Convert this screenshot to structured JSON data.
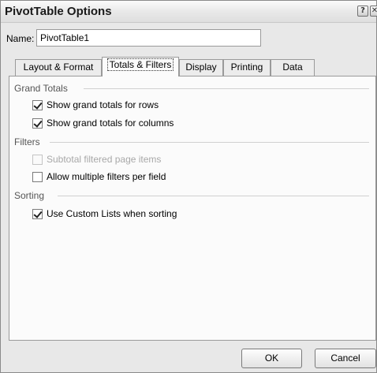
{
  "window": {
    "title": "PivotTable Options",
    "help_glyph": "?",
    "close_glyph": "✕"
  },
  "name_field": {
    "label": "Name:",
    "value": "PivotTable1"
  },
  "tabs": [
    {
      "label": "Layout & Format"
    },
    {
      "label": "Totals & Filters",
      "active": true
    },
    {
      "label": "Display"
    },
    {
      "label": "Printing"
    },
    {
      "label": "Data"
    }
  ],
  "grand_totals": {
    "heading": "Grand Totals",
    "show_rows": {
      "label": "Show grand totals for rows",
      "checked": true
    },
    "show_columns": {
      "label": "Show grand totals for columns",
      "checked": true
    }
  },
  "filters": {
    "heading": "Filters",
    "subtotal_filtered": {
      "label": "Subtotal filtered page items",
      "checked": false,
      "disabled": true
    },
    "allow_multiple": {
      "label": "Allow multiple filters per field",
      "checked": false
    }
  },
  "sorting": {
    "heading": "Sorting",
    "custom_lists": {
      "label": "Use Custom Lists when sorting",
      "checked": true
    }
  },
  "buttons": {
    "ok": "OK",
    "cancel": "Cancel"
  }
}
